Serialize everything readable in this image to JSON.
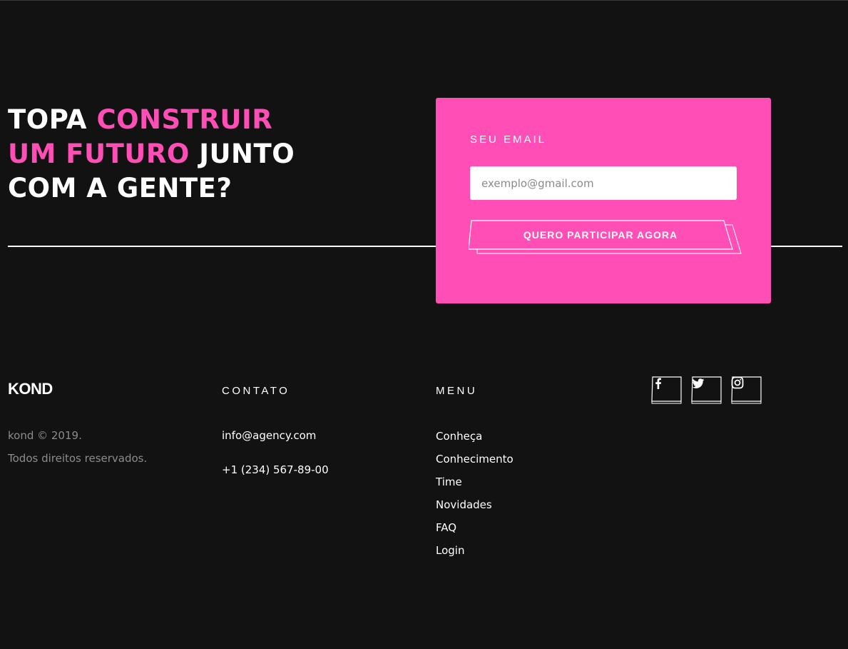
{
  "hero": {
    "line1_white": "TOPA",
    "line1_pink": "CONSTRUIR",
    "line2_pink": "UM FUTURO",
    "line2_white": "JUNTO",
    "line3_white": "COM A GENTE?"
  },
  "signup": {
    "label": "SEU EMAIL",
    "placeholder": "exemplo@gmail.com",
    "value": "",
    "button_label": "QUERO PARTICIPAR AGORA"
  },
  "footer": {
    "brand": "KOND",
    "copyright": "kond © 2019.",
    "rights": "Todos direitos reservados.",
    "contact": {
      "heading": "CONTATO",
      "email": "info@agency.com",
      "phone": "+1 (234) 567-89-00"
    },
    "menu": {
      "heading": "MENU",
      "items": [
        {
          "label": "Conheça"
        },
        {
          "label": "Conhecimento"
        },
        {
          "label": "Time"
        },
        {
          "label": "Novidades"
        },
        {
          "label": "FAQ"
        },
        {
          "label": "Login"
        }
      ]
    },
    "social": [
      {
        "icon": "facebook-icon"
      },
      {
        "icon": "twitter-icon"
      },
      {
        "icon": "instagram-icon"
      }
    ]
  },
  "colors": {
    "background": "#121212",
    "accent": "#ff4fb7",
    "text": "#ffffff",
    "muted_text": "#8c8c8c"
  }
}
